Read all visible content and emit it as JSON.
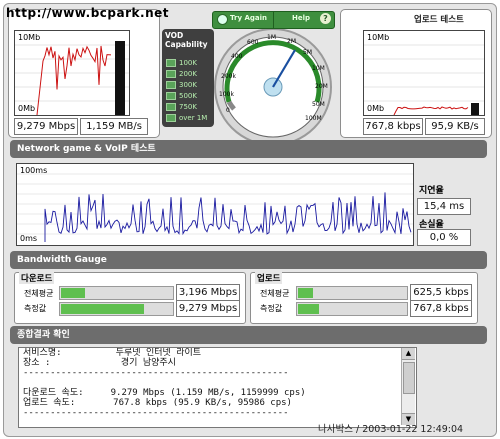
{
  "watermark": "http://www.bcpark.net",
  "download": {
    "graph_top_label": "10Mb",
    "graph_bottom_label": "0Mb",
    "speed_mbps": "9,279 Mbps",
    "speed_mbs": "1,159 MB/s"
  },
  "vod": {
    "title": "VOD Capability",
    "items": [
      "100K",
      "200K",
      "300K",
      "500K",
      "750K",
      "over 1M"
    ]
  },
  "gauge": {
    "try_again_label": "Try Again",
    "help_label": "Help",
    "help_icon_label": "?",
    "ticks": [
      "0",
      "100k",
      "200k",
      "400",
      "600",
      "1M",
      "2M",
      "5M",
      "10M",
      "20M",
      "50M",
      "100M"
    ],
    "needle_value": "10M"
  },
  "upload": {
    "title": "업로드 테스트",
    "graph_top_label": "10Mb",
    "graph_bottom_label": "0Mb",
    "speed_kbps": "767,8 kbps",
    "speed_kbs": "95,9 KB/s"
  },
  "network_game": {
    "header": "Network game & VoIP 테스트",
    "y_top": "100ms",
    "y_bottom": "0ms",
    "latency_label": "지연율",
    "latency_value": "15,4 ms",
    "loss_label": "손실율",
    "loss_value": "0,0 %"
  },
  "bandwidth": {
    "header": "Bandwidth Gauge",
    "download_title": "다운로드",
    "upload_title": "업로드",
    "avg_label": "전체평균",
    "measured_label": "측정값",
    "dl_avg": "3,196 Mbps",
    "dl_measured": "9,279 Mbps",
    "ul_avg": "625,5 kbps",
    "ul_measured": "767,8 kbps",
    "dl_avg_fill": 0.23,
    "dl_measured_fill": 0.75,
    "ul_avg_fill": 0.15,
    "ul_measured_fill": 0.21
  },
  "result": {
    "header": "종합결과 확인",
    "lines": [
      "서비스명:          두루넷 인터넷 라이트",
      "장소 :             경기 남양주시",
      "-------------------------------------------------",
      "",
      "다운로드 속도:     9.279 Mbps (1.159 MB/s, 1159999 cps)",
      "업로드 속도:       767.8 kbps (95.9 KB/s, 95986 cps)",
      "-------------------------------------------------"
    ]
  },
  "footer": "나사박스 / 2003-01-22 12:49:04",
  "colors": {
    "accent_green": "#5fbf4f",
    "graph_red": "#cc1111",
    "graph_blue": "#1a1aa0",
    "header_gray": "#6d6d6d"
  }
}
